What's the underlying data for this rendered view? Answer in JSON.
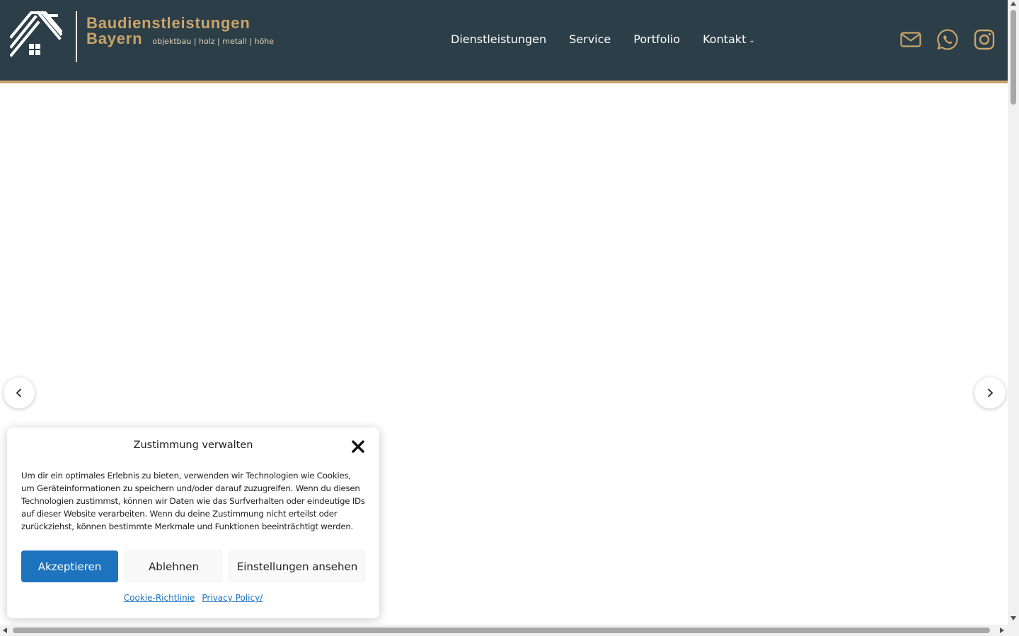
{
  "header": {
    "brand_line1": "Baudienstleistungen",
    "brand_line2": "Bayern",
    "brand_tagline": "objektbau | holz | metall | höhe",
    "colors": {
      "background": "#2c3e48",
      "accent": "#c9a46a"
    }
  },
  "nav": {
    "items": [
      {
        "label": "Dienstleistungen"
      },
      {
        "label": "Service"
      },
      {
        "label": "Portfolio"
      },
      {
        "label": "Kontakt",
        "has_dropdown": true
      }
    ]
  },
  "social": {
    "icons": [
      "mail-icon",
      "whatsapp-icon",
      "instagram-icon"
    ]
  },
  "slider": {
    "prev_icon": "chevron-left-icon",
    "next_icon": "chevron-right-icon"
  },
  "cookie": {
    "title": "Zustimmung verwalten",
    "body": "Um dir ein optimales Erlebnis zu bieten, verwenden wir Technologien wie Cookies, um Geräteinformationen zu speichern und/oder darauf zuzugreifen. Wenn du diesen Technologien zustimmst, können wir Daten wie das Surfverhalten oder eindeutige IDs auf dieser Website verarbeiten. Wenn du deine Zustimmung nicht erteilst oder zurückziehst, können bestimmte Merkmale und Funktionen beeinträchtigt werden.",
    "accept_label": "Akzeptieren",
    "deny_label": "Ablehnen",
    "settings_label": "Einstellungen ansehen",
    "link_cookie_policy": "Cookie-Richtlinie",
    "link_privacy": "Privacy Policy/",
    "colors": {
      "primary": "#1e73be"
    }
  }
}
